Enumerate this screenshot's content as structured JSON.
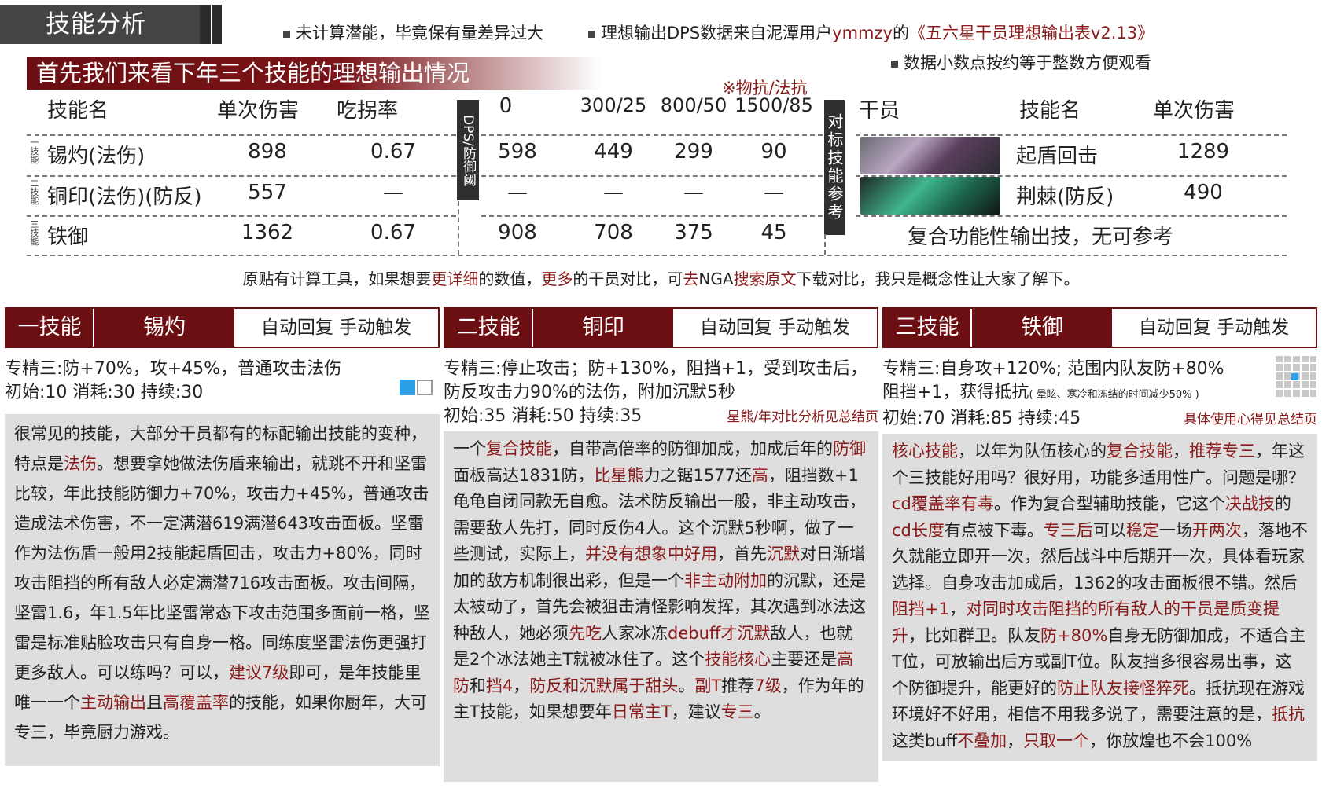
{
  "header": {
    "title": "技能分析",
    "notes": {
      "n1": "未计算潜能，毕竟保有量差异过大",
      "n2_prefix": "理想输出DPS数据来自泥潭用户",
      "n2_user": "ymmzy",
      "n2_mid": "的",
      "n2_source": "《五六星干员理想输出表v2.13》",
      "n3": "数据小数点按约等于整数方便观看"
    }
  },
  "banner": "首先我们来看下年三个技能的理想输出情况",
  "resist_note": "※物抗/法抗",
  "table": {
    "headers": {
      "skill": "技能名",
      "dmg": "单次伤害",
      "eat": "吃拐率",
      "dps_tag": "DPS/防御阈",
      "c0": "0",
      "c1": "300/25",
      "c2": "800/50",
      "c3": "1500/85"
    },
    "side_labels": [
      "一技能",
      "二技能",
      "三技能"
    ],
    "rows": [
      {
        "name": "锡灼(法伤)",
        "dmg": "898",
        "eat": "0.67",
        "v0": "598",
        "v1": "449",
        "v2": "299",
        "v3": "90"
      },
      {
        "name": "铜印(法伤)(防反)",
        "dmg": "557",
        "eat": "—",
        "v0": "—",
        "v1": "—",
        "v2": "—",
        "v3": "—"
      },
      {
        "name": "铁御",
        "dmg": "1362",
        "eat": "0.67",
        "v0": "908",
        "v1": "708",
        "v2": "375",
        "v3": "45"
      }
    ],
    "ref_tag": "对标技能参考",
    "ref_headers": {
      "op": "干员",
      "skill": "技能名",
      "dmg": "单次伤害"
    },
    "ref_rows": [
      {
        "skill": "起盾回击",
        "dmg": "1289"
      },
      {
        "skill": "荆棘(防反)",
        "dmg": "490"
      }
    ],
    "ref_row3": "复合功能性输出技，无可参考"
  },
  "bottom_note": {
    "p1": "原贴有计算工具，如果想要",
    "r1": "更详细",
    "p2": "的数值，",
    "r2": "更多",
    "p3": "的干员对比，可",
    "r3": "去",
    "p4": "NGA",
    "r4": "搜索原文",
    "p5": "下载对比，我只是概念性让大家了解下。"
  },
  "skills": [
    {
      "no": "一技能",
      "name": "锡灼",
      "trigger": "自动回复 手动触发",
      "spec1": "专精三:防+70%，攻+45%，普通攻击法伤",
      "spec2": "初始:10 消耗:30 持续:30",
      "desc": [
        [
          "很常见的技能，大部分干员都有的标配输出技能的变种，特点是",
          "法伤",
          "。想要拿她做法伤盾来输出，就跳不开和坚雷比较，年此技能防御力+70%，攻击力+45%，普通攻击造成法术伤害，不一定满潜619满潜643攻击面板。坚雷作为法伤盾一般用2技能起盾回击，攻击力+80%，同时攻击阻挡的所有敌人必定满潜716攻击面板。攻击间隔，坚雷1.6，年1.5年比坚雷常态下攻击范围多面前一格，坚雷是标准贴脸攻击只有自身一格。同练度坚雷法伤更强打更多敌人。可以练吗？可以，",
          "建议7级",
          "即可，是年技能里唯一一个",
          "主动输出",
          "且",
          "高覆盖率",
          "的技能，如果你厨年，大可专三，毕竟厨力游戏。"
        ]
      ]
    },
    {
      "no": "二技能",
      "name": "铜印",
      "trigger": "自动回复 手动触发",
      "spec1": "专精三:停止攻击；防+130%，阻挡+1，受到攻击后，防反攻击力90%的法伤，附加沉默5秒",
      "spec2": "初始:35 消耗:50 持续:35",
      "side": "星熊/年对比分析见总结页",
      "desc": [
        [
          "一个",
          "复合技能",
          "，自带高倍率的防御加成，加成后年的",
          "防御",
          "面板高达1831防，",
          "比星熊",
          "力之锯1577还",
          "高",
          "，阻挡数+1龟龟自闭同款无自愈。法术防反输出一般，非主动攻击，需要敌人先打，同时反伤4人。这个沉默5秒啊，做了一些测试，实际上，",
          "并没有想象中好用",
          "，首先",
          "沉默",
          "对日渐增加的敌方机制很出彩，但是一个",
          "非主动附加",
          "的沉默，还是太被动了，首先会被狙击清怪影响发挥，其次遇到冰法这种敌人，她必须",
          "先吃",
          "人家冰冻",
          "debuff才沉默",
          "敌人，也就是2个冰法她主T就被冰住了。这个",
          "技能核心",
          "主要还是",
          "高防",
          "和",
          "挡4",
          "，",
          "防反和沉默属于甜头",
          "。",
          "副T",
          "推荐",
          "7级",
          "，作为年的主T技能，如果想要年",
          "日常主T",
          "，建议",
          "专三",
          "。"
        ]
      ]
    },
    {
      "no": "三技能",
      "name": "铁御",
      "trigger": "自动回复 手动触发",
      "spec1": "专精三:自身攻+120%; 范围内队友防+80%",
      "spec2": "阻挡+1，获得抵抗",
      "spec2_small": "( 晕眩、寒冷和冻结的时间减少50% )",
      "spec3": "初始:70 消耗:85 持续:45",
      "side": "具体使用心得见总结页",
      "desc": [
        [
          "",
          "核心技能",
          "，以年为队伍核心的",
          "复合技能",
          "，",
          "推荐专三",
          "，年这个三技能好用吗？很好用，功能多适用性广。问题是哪？",
          "cd覆盖率有毒",
          "。作为复合型辅助技能，它这个",
          "决战技",
          "的",
          "cd长度",
          "有点被下毒。",
          "专三后",
          "可以",
          "稳定",
          "一场",
          "开两次",
          "，落地不久就能立即开一次，然后战斗中后期开一次，具体看玩家选择。自身攻击加成后，1362的攻击面板很不错。然后",
          "阻挡+1",
          "，",
          "对同时攻击阻挡的所有敌人的干员是质变提升",
          "，比如群卫。队友",
          "防+80%",
          "自身无防御加成，不适合主T位，可放输出后方或副T位。队友挡多很容易出事，这个防御提升，能更好的",
          "防止队友接怪猝死",
          "。抵抗现在游戏环境好不好用，相信不用我多说了，需要注意的是，",
          "抵抗",
          "这类buff",
          "不叠加",
          "，",
          "只取一个",
          "，你放煌也不会100%"
        ]
      ]
    }
  ]
}
